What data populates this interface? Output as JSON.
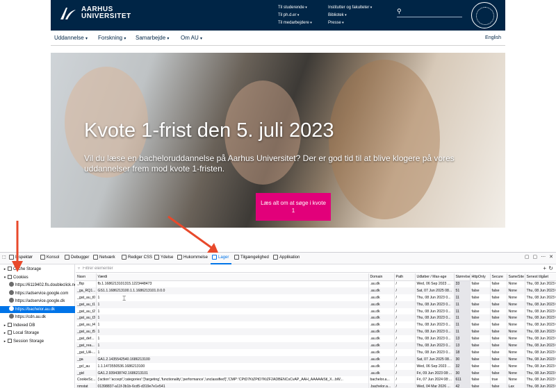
{
  "site": {
    "logo": {
      "line1": "AARHUS",
      "line2": "UNIVERSITET"
    },
    "utility_nav": {
      "col1": [
        "Til studerende",
        "Til ph.d.er",
        "Til medarbejdere"
      ],
      "col2": [
        "Institutter og fakulteter",
        "Bibliotek",
        "Presse"
      ]
    },
    "main_nav": [
      "Uddannelse",
      "Forskning",
      "Samarbejde",
      "Om AU"
    ],
    "language": "English",
    "hero": {
      "title": "Kvote 1-frist den 5. juli 2023",
      "subtitle": "Vil du læse en bacheloruddannelse på Aarhus Universitet? Der er god tid til at blive klogere på vores uddannelser frem mod kvote 1-fristen.",
      "cta": "Læs alt om at søge i kvote 1"
    },
    "colors": {
      "header": "#002546",
      "cta": "#e2007a"
    }
  },
  "devtools": {
    "tabs": [
      {
        "label": "Inspektør",
        "icon": "inspector-icon"
      },
      {
        "label": "Konsol",
        "icon": "console-icon"
      },
      {
        "label": "Debugger",
        "icon": "debugger-icon"
      },
      {
        "label": "Netværk",
        "icon": "network-icon"
      },
      {
        "label": "Rediger CSS",
        "icon": "style-editor-icon"
      },
      {
        "label": "Ydelse",
        "icon": "performance-icon"
      },
      {
        "label": "Hukommelse",
        "icon": "memory-icon"
      },
      {
        "label": "Lager",
        "icon": "storage-icon"
      },
      {
        "label": "Tilgængelighed",
        "icon": "accessibility-icon"
      },
      {
        "label": "Applikation",
        "icon": "application-icon"
      }
    ],
    "active_tab": "Lager",
    "filter_placeholder": "Filtrer elementer",
    "tree": [
      {
        "label": "Cache Storage",
        "level": 0,
        "expanded": false
      },
      {
        "label": "Cookies",
        "level": 0,
        "expanded": true
      },
      {
        "label": "https://6119402.fls.doubleclick.net",
        "level": 1
      },
      {
        "label": "https://adservice.google.com",
        "level": 1
      },
      {
        "label": "https://adservice.google.dk",
        "level": 1
      },
      {
        "label": "https://bachelor.au.dk",
        "level": 1,
        "selected": true
      },
      {
        "label": "https://cdn.au.dk",
        "level": 1
      },
      {
        "label": "Indexed DB",
        "level": 0,
        "expanded": false
      },
      {
        "label": "Local Storage",
        "level": 0,
        "expanded": false
      },
      {
        "label": "Session Storage",
        "level": 0,
        "expanded": false
      }
    ],
    "columns": [
      "Navn",
      "Værdi",
      "Domain",
      "Path",
      "Udløber / Max-age",
      "Størrelse",
      "HttpOnly",
      "Secure",
      "SameSite",
      "Senest tilgået"
    ],
    "rows": [
      [
        "_fbp",
        "fb.1.1686213101315.1223448473",
        ".au.dk",
        "/",
        "Wed, 06 Sep 2023 ...",
        "33",
        "false",
        "false",
        "None",
        "Thu, 08 Jun 2023 0..."
      ],
      [
        "_ga_RQ1...",
        "GS1.1.1686213100.1.1.1686213101.0.0.0",
        ".au.dk",
        "/",
        "Sat, 07 Jun 2025 08...",
        "51",
        "false",
        "false",
        "None",
        "Thu, 08 Jun 2023 0..."
      ],
      [
        "_gat_au_t0",
        "1",
        ".au.dk",
        "/",
        "Thu, 08 Jun 2023 0...",
        "11",
        "false",
        "false",
        "None",
        "Thu, 08 Jun 2023 0..."
      ],
      [
        "_gat_au_t1",
        "1",
        ".au.dk",
        "/",
        "Thu, 08 Jun 2023 0...",
        "11",
        "false",
        "false",
        "None",
        "Thu, 08 Jun 2023 0..."
      ],
      [
        "_gat_au_t2",
        "1",
        ".au.dk",
        "/",
        "Thu, 08 Jun 2023 0...",
        "11",
        "false",
        "false",
        "None",
        "Thu, 08 Jun 2023 0..."
      ],
      [
        "_gat_au_t3",
        "1",
        ".au.dk",
        "/",
        "Thu, 08 Jun 2023 0...",
        "11",
        "false",
        "false",
        "None",
        "Thu, 08 Jun 2023 0..."
      ],
      [
        "_gat_au_t4",
        "1",
        ".au.dk",
        "/",
        "Thu, 08 Jun 2023 0...",
        "11",
        "false",
        "false",
        "None",
        "Thu, 08 Jun 2023 0..."
      ],
      [
        "_gat_au_t5",
        "1",
        ".au.dk",
        "/",
        "Thu, 08 Jun 2023 0...",
        "11",
        "false",
        "false",
        "None",
        "Thu, 08 Jun 2023 0..."
      ],
      [
        "_gat_def...",
        "1",
        ".au.dk",
        "/",
        "Thu, 08 Jun 2023 0...",
        "13",
        "false",
        "false",
        "None",
        "Thu, 08 Jun 2023 0..."
      ],
      [
        "_gat_rea...",
        "1",
        ".au.dk",
        "/",
        "Thu, 08 Jun 2023 0...",
        "13",
        "false",
        "false",
        "None",
        "Thu, 08 Jun 2023 0..."
      ],
      [
        "_gat_UA-...",
        "1",
        ".au.dk",
        "/",
        "Thu, 08 Jun 2023 0...",
        "18",
        "false",
        "false",
        "None",
        "Thu, 08 Jun 2023 0..."
      ],
      [
        "_ga",
        "GA1.2.1435542540.1686213100",
        ".au.dk",
        "/",
        "Sat, 07 Jun 2025 08...",
        "30",
        "false",
        "false",
        "None",
        "Thu, 08 Jun 2023 0..."
      ],
      [
        "_gcl_au",
        "1.1.1473550536.1686213100",
        ".au.dk",
        "/",
        "Wed, 06 Sep 2023 ...",
        "32",
        "false",
        "false",
        "None",
        "Thu, 08 Jun 2023 0..."
      ],
      [
        "_gid",
        "GA1.2.939438742.1686213101",
        ".au.dk",
        "/",
        "Fri, 09 Jun 2023 08:...",
        "30",
        "false",
        "false",
        "None",
        "Thu, 08 Jun 2023 0..."
      ],
      [
        "CookieSc...",
        "{'action':'accept','categories':'['targeting','functionality','performance','unclassified']','CMP':'CPtD7KtZPtD7KtZF2ADBENCsCvAP_AAH_AAAAAiStl_X...bW...",
        "bachelor.a...",
        "/",
        "Fri, 07 Jun 2024 08:...",
        "611",
        "false",
        "true",
        "None",
        "Thu, 08 Jun 2023 0..."
      ],
      [
        "nmstat",
        "01398837-a11f-3b1b-6cd5-d319e7e1e541",
        ".bachelor.a...",
        "/",
        "Wed, 04 Mar 2026 ...",
        "42",
        "false",
        "false",
        "Lax",
        "Thu, 08 Jun 2023 0..."
      ]
    ]
  }
}
